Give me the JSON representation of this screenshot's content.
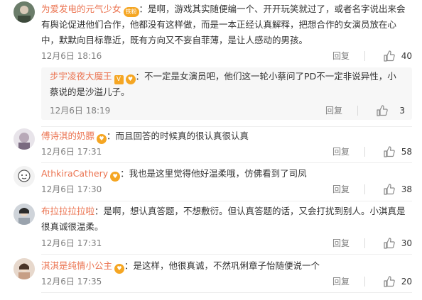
{
  "comments": [
    {
      "username": "为爱发电的元气少女",
      "badge": "铁粉",
      "text": "是啊，游戏其实随便编一个、开开玩笑就过了，或者名字说出来会有舆论促进他们合作，他都没有这样做，而是一本正经认真解释，把想合作的女演员放在心中，默默向目标靠近，既有方向又不妄自菲薄，是让人感动的男孩。",
      "time": "12月6日 18:16",
      "reply_label": "回复",
      "likes": "40",
      "sub": {
        "username": "步宇凌夜大魔王",
        "badge_v": "V",
        "text": "不一定是女演员吧，他们这一轮小蔡问了PD不一定非说异性，小蔡说的是沙溢儿子。",
        "time": "12月6日 18:19",
        "reply_label": "回复",
        "likes": "3"
      }
    },
    {
      "username": "傅诗淇的奶膘",
      "text": "而且回答的时候真的很认真很认真",
      "time": "12月6日 17:31",
      "reply_label": "回复",
      "likes": "58"
    },
    {
      "username": "AthkiraCathery",
      "text": "我也是这里觉得他好温柔哦，仿佛看到了司凤",
      "time": "12月6日 17:30",
      "reply_label": "回复",
      "likes": "38"
    },
    {
      "username": "布拉拉拉拉啦",
      "text": "是啊，想认真答题，不想敷衍。但认真答题的话，又会打扰到别人。小淇真是很真诚很温柔。",
      "time": "12月6日 17:31",
      "reply_label": "回复",
      "likes": "30"
    },
    {
      "username": "淇淇是纯情小公主",
      "text": "是这样，他很真诚，不然巩俐章子怡随便说一个",
      "time": "12月6日 17:35",
      "reply_label": "回复",
      "likes": "20"
    }
  ],
  "colors": {
    "username": "#eb7350",
    "meta": "#808080",
    "badge": "#f5a623",
    "subbox": "#f7f7f7"
  },
  "icons": {
    "like": "thumbs-up-icon",
    "fan_badge": "fan-badge-icon"
  }
}
